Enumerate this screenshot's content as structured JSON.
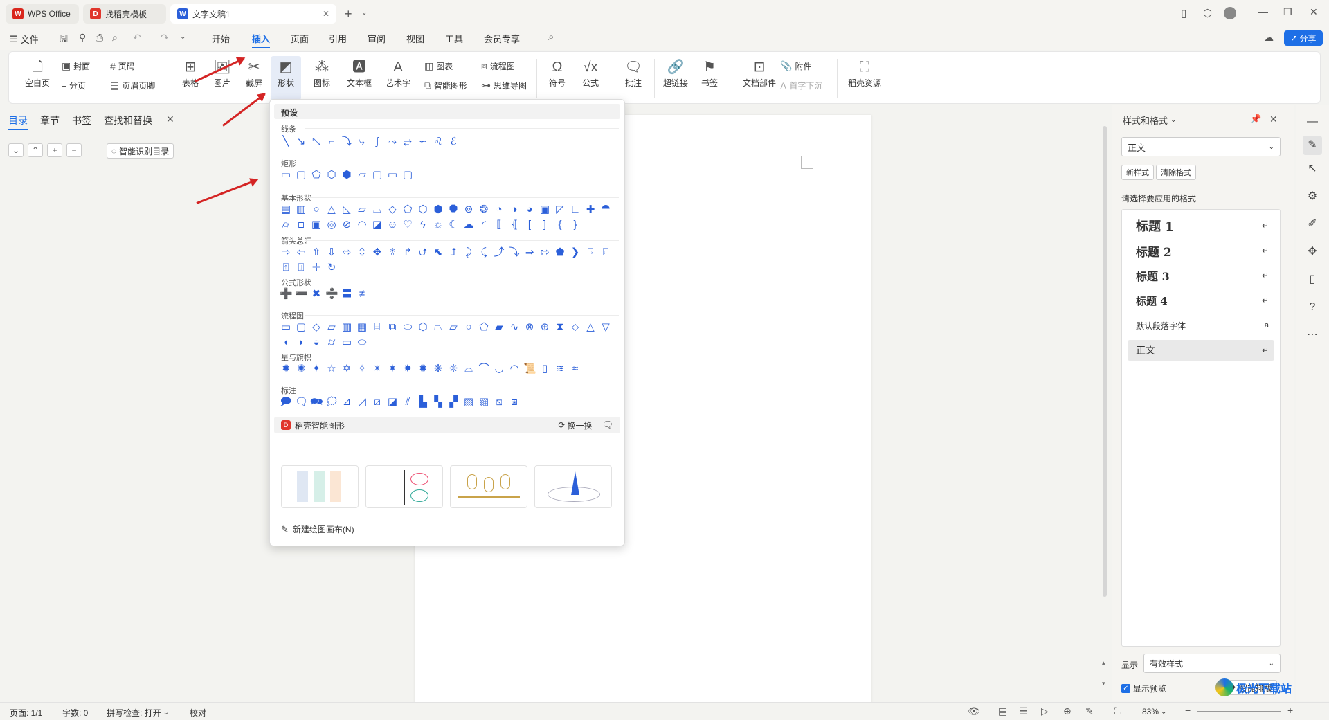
{
  "tabs": [
    {
      "label": "WPS Office",
      "icon": "wps-logo-icon",
      "color": "#d9261c"
    },
    {
      "label": "找稻壳模板",
      "icon": "docer-logo-icon",
      "color": "#e0362c"
    },
    {
      "label": "文字文稿1",
      "icon": "writer-logo-icon",
      "color": "#2b5fd9"
    }
  ],
  "menu": {
    "file": "文件",
    "tabs": [
      "开始",
      "插入",
      "页面",
      "引用",
      "审阅",
      "视图",
      "工具",
      "会员专享"
    ],
    "active": "插入",
    "share": "分享"
  },
  "ribbon": {
    "blank_page": "空白页",
    "cover": "封面",
    "page_break": "分页",
    "page_num": "页码",
    "header_footer": "页眉页脚",
    "table": "表格",
    "picture": "图片",
    "screenshot": "截屏",
    "shape": "形状",
    "icon": "图标",
    "textbox": "文本框",
    "wordart": "艺术字",
    "chart": "图表",
    "smartart": "智能图形",
    "flowchart": "流程图",
    "mindmap": "思维导图",
    "symbol": "符号",
    "formula": "公式",
    "comment": "批注",
    "hyperlink": "超链接",
    "bookmark": "书签",
    "doc_parts": "文档部件",
    "attachment": "附件",
    "dropcap": "首字下沉",
    "docer": "稻壳资源"
  },
  "leftpane": {
    "tabs": [
      "目录",
      "章节",
      "书签",
      "查找和替换"
    ],
    "smart_toc": "智能识别目录"
  },
  "shapes_panel": {
    "preset": "预设",
    "sections": [
      "线条",
      "矩形",
      "基本形状",
      "箭头总汇",
      "公式形状",
      "流程图",
      "星与旗帜",
      "标注"
    ],
    "smart_title": "稻壳智能图形",
    "refresh": "换一换",
    "new_canvas": "新建绘图画布(N)"
  },
  "rightpane": {
    "title": "样式和格式",
    "current_style": "正文",
    "new_style": "新样式",
    "clear_format": "清除格式",
    "apply_label": "请选择要应用的格式",
    "styles": [
      "标题 1",
      "标题 2",
      "标题 3",
      "标题 4",
      "默认段落字体",
      "正文"
    ],
    "show_label": "显示",
    "show_value": "有效样式",
    "preview": "显示预览",
    "smart_layout": "智能排版"
  },
  "status": {
    "page": "页面: 1/1",
    "words": "字数: 0",
    "spell": "拼写检查: 打开",
    "proof": "校对",
    "zoom": "83%"
  },
  "watermark": "极光下载站"
}
